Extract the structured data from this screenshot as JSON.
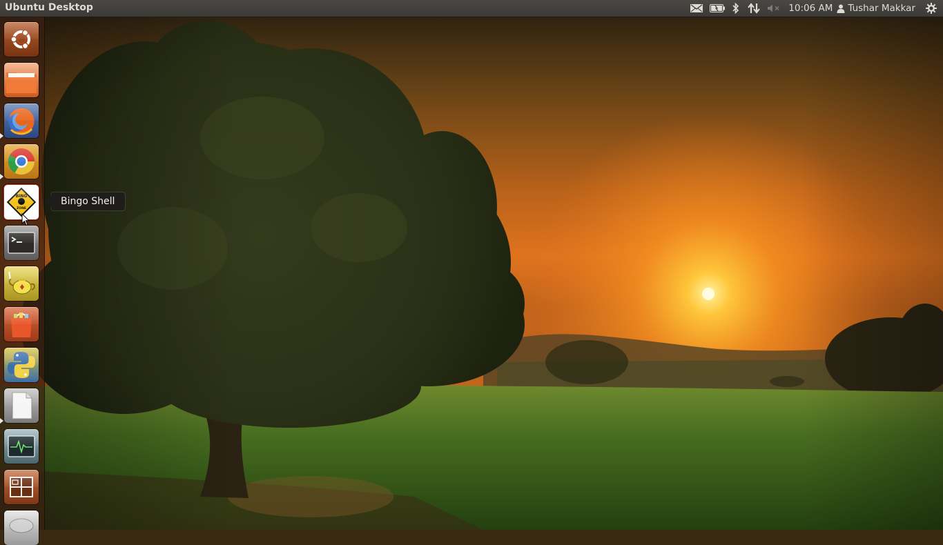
{
  "top_panel": {
    "title": "Ubuntu Desktop",
    "clock": "10:06 AM",
    "user": "Tushar Makkar",
    "indicator_icons": [
      "mail-icon",
      "battery-icon",
      "bluetooth-icon",
      "network-icon",
      "volume-muted-icon",
      "session-gear-icon"
    ]
  },
  "launcher": {
    "items": [
      {
        "name": "dash-home",
        "icon": "ubuntu-logo-icon",
        "running": false
      },
      {
        "name": "files",
        "icon": "folder-icon",
        "running": false
      },
      {
        "name": "firefox",
        "icon": "firefox-icon",
        "running": true
      },
      {
        "name": "chromium",
        "icon": "chrome-icon",
        "running": true
      },
      {
        "name": "bingo-shell",
        "icon": "bingo-zone-icon",
        "running": false,
        "hovered": true
      },
      {
        "name": "terminal",
        "icon": "terminal-icon",
        "running": false
      },
      {
        "name": "tea-app",
        "icon": "teapot-icon",
        "running": false
      },
      {
        "name": "software-center",
        "icon": "shopping-bag-icon",
        "running": false
      },
      {
        "name": "python",
        "icon": "python-icon",
        "running": false
      },
      {
        "name": "text-document",
        "icon": "document-icon",
        "running": true
      },
      {
        "name": "system-monitor",
        "icon": "system-monitor-icon",
        "running": false
      },
      {
        "name": "workspace-switcher",
        "icon": "workspace-icon",
        "running": false
      },
      {
        "name": "drive",
        "icon": "drive-icon",
        "running": false
      }
    ]
  },
  "tooltip": {
    "text": "Bingo Shell"
  },
  "colors": {
    "panel_bg": "#3c3b37",
    "panel_text": "#dfdbd2",
    "launcher_bg": "#3c2010",
    "tooltip_bg": "#1f1d1b",
    "sky_top": "#3c2810",
    "sun": "#fff6c0",
    "grass": "#3f6a1e"
  }
}
